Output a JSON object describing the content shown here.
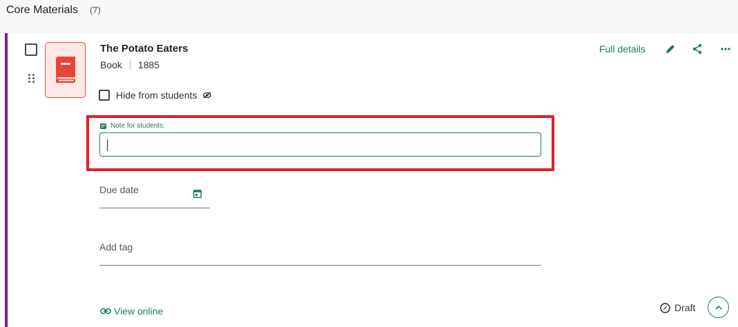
{
  "section": {
    "title": "Core Materials",
    "count": "(7)"
  },
  "item": {
    "title": "The Potato Eaters",
    "type": "Book",
    "year": "1885",
    "full_details_label": "Full details"
  },
  "hide_from_students": {
    "label": "Hide from students",
    "checked": false
  },
  "note": {
    "label": "Note for students:",
    "value": ""
  },
  "due_date": {
    "label": "Due date"
  },
  "add_tag": {
    "label": "Add tag"
  },
  "view_online": {
    "label": "View online"
  },
  "status": {
    "label": "Draft"
  },
  "icons": {
    "book": "book-icon",
    "edit": "pencil-icon",
    "share": "share-icon",
    "more": "more-horizontal-icon",
    "hide": "eye-off-icon",
    "note": "note-icon",
    "calendar": "calendar-icon",
    "link": "link-icon",
    "draft": "compass-icon",
    "collapse": "chevron-up-icon",
    "drag": "drag-handle-icon"
  },
  "colors": {
    "accent": "#1f7a5c",
    "card_border": "#7b1f8a",
    "highlight": "#e11d2a",
    "thumb": "#e8443a"
  }
}
